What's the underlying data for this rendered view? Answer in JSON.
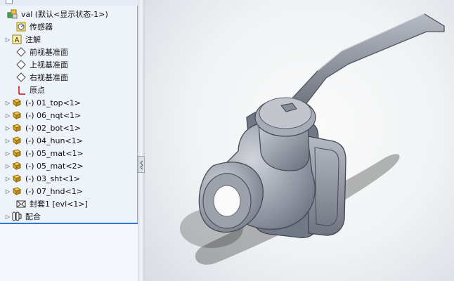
{
  "feature_tree": {
    "items": [
      {
        "label": "val (默认<显示状态-1>)",
        "icon": "assembly-icon"
      },
      {
        "label": "传感器",
        "icon": "sensor-icon"
      },
      {
        "label": "注解",
        "icon": "annotation-icon"
      },
      {
        "label": "前视基准面",
        "icon": "plane-icon"
      },
      {
        "label": "上视基准面",
        "icon": "plane-icon"
      },
      {
        "label": "右视基准面",
        "icon": "plane-icon"
      },
      {
        "label": "原点",
        "icon": "origin-icon"
      },
      {
        "label": "(-) 01_top<1>",
        "icon": "part-icon"
      },
      {
        "label": "(-) 06_nqt<1>",
        "icon": "part-icon"
      },
      {
        "label": "(-) 02_bot<1>",
        "icon": "part-icon"
      },
      {
        "label": "(-) 04_hun<1>",
        "icon": "part-icon"
      },
      {
        "label": "(-) 05_mat<1>",
        "icon": "part-icon"
      },
      {
        "label": "(-) 05_mat<2>",
        "icon": "part-icon"
      },
      {
        "label": "(-) 03_sht<1>",
        "icon": "part-icon"
      },
      {
        "label": "(-) 07_hnd<1>",
        "icon": "part-icon"
      },
      {
        "label": "封套1 [evl<1>]",
        "icon": "envelope-icon"
      },
      {
        "label": "配合",
        "icon": "mates-icon"
      }
    ]
  },
  "colors": {
    "tree_background": "#eef3fa",
    "selection_line": "#2e74d7",
    "part_icon": "#e0b43a",
    "model_body": "#8c919e"
  }
}
